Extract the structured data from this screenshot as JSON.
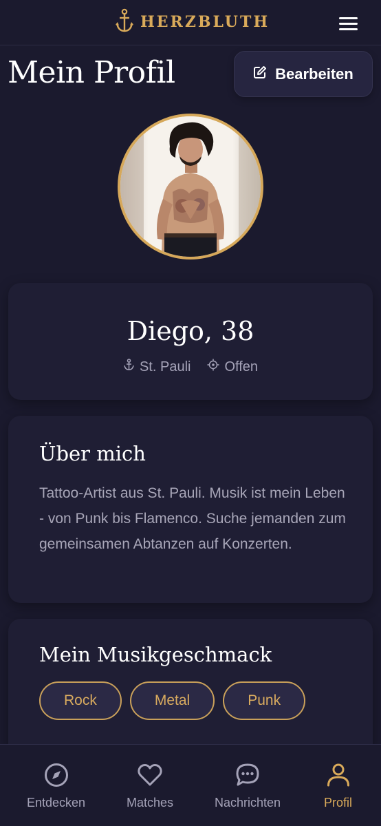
{
  "header": {
    "brand": "HERZBLUTH"
  },
  "page": {
    "title": "Mein Profil",
    "edit_label": "Bearbeiten"
  },
  "profile": {
    "name": "Diego, 38",
    "location": "St. Pauli",
    "status": "Offen"
  },
  "about": {
    "heading": "Über mich",
    "text": "Tattoo-Artist aus St. Pauli. Musik ist mein Leben - von Punk bis Flamenco. Suche jemanden zum gemeinsamen Abtanzen auf Konzerten."
  },
  "music": {
    "heading": "Mein Musikgeschmack",
    "tags": [
      "Rock",
      "Metal",
      "Punk"
    ]
  },
  "nav": {
    "items": [
      {
        "label": "Entdecken",
        "icon": "compass-icon"
      },
      {
        "label": "Matches",
        "icon": "heart-icon"
      },
      {
        "label": "Nachrichten",
        "icon": "chat-icon"
      },
      {
        "label": "Profil",
        "icon": "user-icon"
      }
    ],
    "active": "Profil"
  },
  "colors": {
    "accent": "#d9aa5a",
    "background": "#1b1a2e",
    "card": "#1f1e34",
    "muted": "#a5a3b8"
  }
}
